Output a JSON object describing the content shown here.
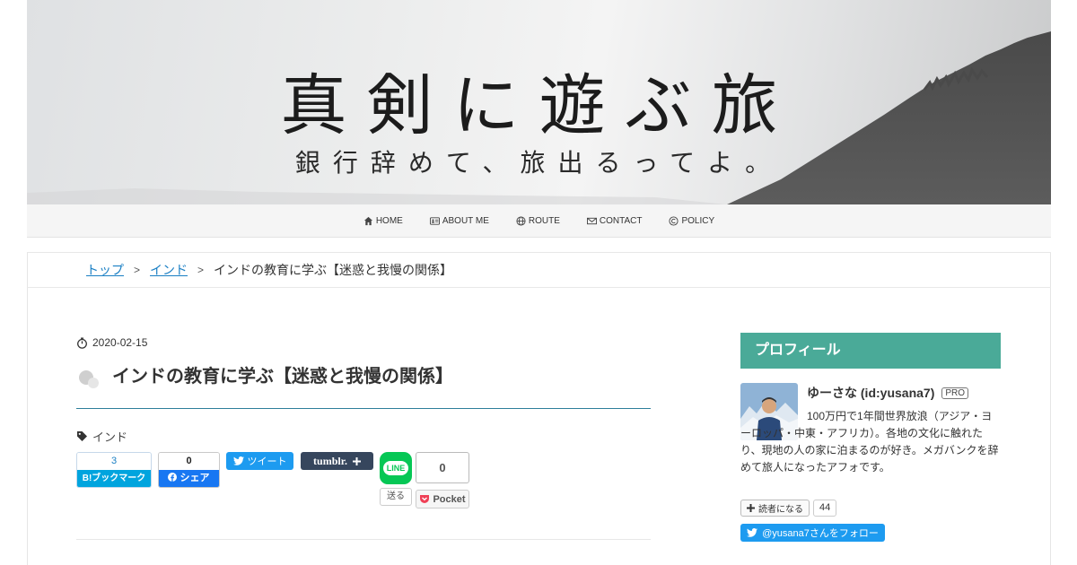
{
  "header": {
    "title": "真剣に遊ぶ旅",
    "subtitle": "銀行辞めて、旅出るってよ。"
  },
  "nav": {
    "items": [
      {
        "label": "HOME",
        "icon": "home-icon"
      },
      {
        "label": "ABOUT ME",
        "icon": "id-card-icon"
      },
      {
        "label": "ROUTE",
        "icon": "globe-icon"
      },
      {
        "label": "CONTACT",
        "icon": "envelope-icon"
      },
      {
        "label": "POLICY",
        "icon": "copyright-icon"
      }
    ]
  },
  "breadcrumb": {
    "top": "トップ",
    "sep": ">",
    "category": "インド",
    "current": "インドの教育に学ぶ【迷惑と我慢の関係】"
  },
  "article": {
    "date": "2020-02-15",
    "title": "インドの教育に学ぶ【迷惑と我慢の関係】",
    "category": "インド"
  },
  "share": {
    "hatena_count": "3",
    "hatena_label": "B!ブックマーク",
    "facebook_count": "0",
    "facebook_label": "シェア",
    "twitter_label": "ツイート",
    "tumblr_label": "tumblr.",
    "line_label": "LINE",
    "line_send": "送る",
    "pocket_count": "0",
    "pocket_label": "Pocket"
  },
  "sidebar": {
    "heading": "プロフィール",
    "name": "ゆーさな (id:yusana7)",
    "badge": "PRO",
    "description": "100万円で1年間世界放浪（アジア・ヨーロッパ・中東・アフリカ）。各地の文化に触れたり、現地の人の家に泊まるのが好き。メガバンクを辞めて旅人になったアフォです。",
    "reader_label": "読者になる",
    "reader_count": "44",
    "follow_label": "@yusana7さんをフォロー"
  },
  "colors": {
    "accent": "#4aaa98",
    "link": "#1a7fc4",
    "title_rule": "#2d7e9a",
    "twitter": "#1d9bf0",
    "facebook": "#1877f2",
    "hatena": "#00a4de",
    "line": "#06c755",
    "tumblr": "#36465d"
  }
}
